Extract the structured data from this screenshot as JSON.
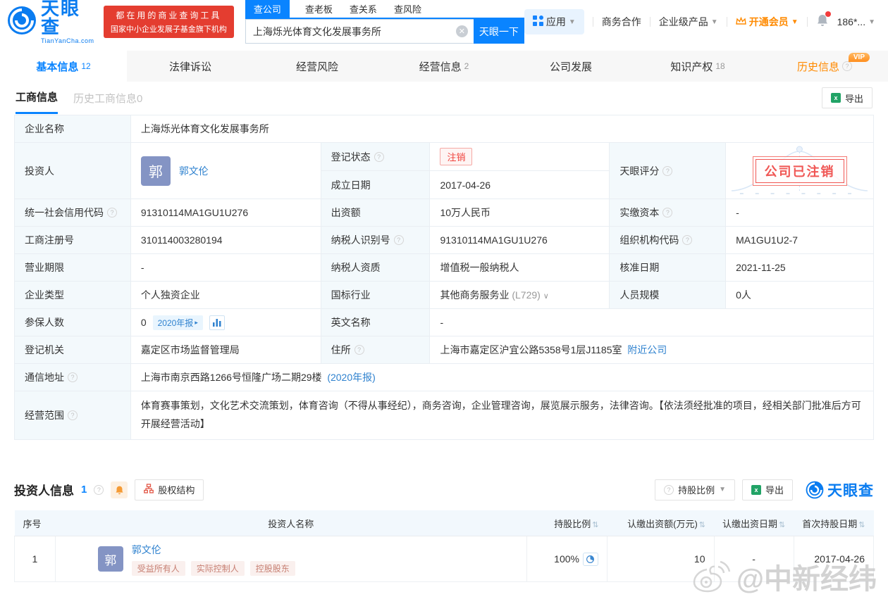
{
  "colors": {
    "accent": "#0a84ff",
    "danger": "#f0413b",
    "orange": "#ff8a00",
    "link": "#2f82cf",
    "label_bg": "#f3f9fc"
  },
  "header": {
    "logo": {
      "title": "天眼查",
      "subtitle": "TianYanCha.com"
    },
    "promo": {
      "line1": "都在用的商业查询工具",
      "line2": "国家中小企业发展子基金旗下机构"
    },
    "search": {
      "tabs": [
        {
          "label": "查公司"
        },
        {
          "label": "查老板"
        },
        {
          "label": "查关系"
        },
        {
          "label": "查风险"
        }
      ],
      "value": "上海烁光体育文化发展事务所",
      "button": "天眼一下"
    },
    "nav": {
      "apps": "应用",
      "coop": "商务合作",
      "enterprise": "企业级产品",
      "vip": "开通会员",
      "phone": "186*..."
    }
  },
  "tabs": [
    {
      "label": "基本信息",
      "count": "12"
    },
    {
      "label": "法律诉讼",
      "count": ""
    },
    {
      "label": "经营风险",
      "count": ""
    },
    {
      "label": "经营信息",
      "count": "2"
    },
    {
      "label": "公司发展",
      "count": ""
    },
    {
      "label": "知识产权",
      "count": "18"
    },
    {
      "label": "历史信息",
      "count": "",
      "vip": "VIP"
    }
  ],
  "subtabs": {
    "primary": "工商信息",
    "secondary": "历史工商信息0",
    "export": "导出"
  },
  "info": {
    "company_name": {
      "label": "企业名称",
      "value": "上海烁光体育文化发展事务所"
    },
    "investor": {
      "label": "投资人",
      "avatar": "郭",
      "name": "郭文伦"
    },
    "reg_status": {
      "label": "登记状态",
      "value": "注销"
    },
    "est_date": {
      "label": "成立日期",
      "value": "2017-04-26"
    },
    "score": {
      "label": "天眼评分",
      "stamp": "公司已注销"
    },
    "credit_code": {
      "label": "统一社会信用代码",
      "value": "91310114MA1GU1U276"
    },
    "capital": {
      "label": "出资额",
      "value": "10万人民币"
    },
    "paid_capital": {
      "label": "实缴资本",
      "value": "-"
    },
    "reg_number": {
      "label": "工商注册号",
      "value": "310114003280194"
    },
    "taxpayer_id": {
      "label": "纳税人识别号",
      "value": "91310114MA1GU1U276"
    },
    "org_code": {
      "label": "组织机构代码",
      "value": "MA1GU1U2-7"
    },
    "business_term": {
      "label": "营业期限",
      "value": "-"
    },
    "taxpayer_quality": {
      "label": "纳税人资质",
      "value": "增值税一般纳税人"
    },
    "approval_date": {
      "label": "核准日期",
      "value": "2021-11-25"
    },
    "company_type": {
      "label": "企业类型",
      "value": "个人独资企业"
    },
    "industry": {
      "label": "国标行业",
      "value": "其他商务服务业",
      "code": "(L729)"
    },
    "staff_size": {
      "label": "人员规模",
      "value": "0人"
    },
    "insured": {
      "label": "参保人数",
      "value": "0",
      "report": "2020年报"
    },
    "english_name": {
      "label": "英文名称",
      "value": "-"
    },
    "reg_authority": {
      "label": "登记机关",
      "value": "嘉定区市场监督管理局"
    },
    "address": {
      "label": "住所",
      "value": "上海市嘉定区沪宜公路5358号1层J1185室",
      "link": "附近公司"
    },
    "mail_address": {
      "label": "通信地址",
      "value": "上海市南京西路1266号恒隆广场二期29楼",
      "link": "(2020年报)"
    },
    "business_scope": {
      "label": "经营范围",
      "value": "体育赛事策划，文化艺术交流策划，体育咨询（不得从事经纪），商务咨询，企业管理咨询，展览展示服务，法律咨询。【依法须经批准的项目，经相关部门批准后方可开展经营活动】"
    }
  },
  "investors": {
    "title": "投资人信息",
    "count": "1",
    "equity_button": "股权结构",
    "ratio_button": "持股比例",
    "export_button": "导出",
    "brand": "天眼查",
    "columns": [
      "序号",
      "投资人名称",
      "持股比例",
      "认缴出资额(万元)",
      "认缴出资日期",
      "首次持股日期"
    ],
    "rows": [
      {
        "seq": "1",
        "avatar": "郭",
        "name": "郭文伦",
        "tags": [
          "受益所有人",
          "实际控制人",
          "控股股东"
        ],
        "ratio": "100%",
        "amount": "10",
        "sub_date": "-",
        "first_date": "2017-04-26"
      }
    ]
  },
  "watermark": "@中新经纬"
}
